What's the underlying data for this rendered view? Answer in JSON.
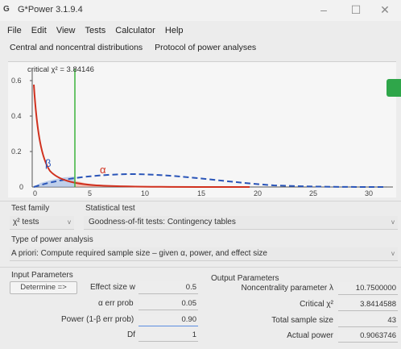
{
  "window": {
    "title": "G*Power 3.1.9.4",
    "icon": "gpower-icon"
  },
  "menu": [
    "File",
    "Edit",
    "View",
    "Tests",
    "Calculator",
    "Help"
  ],
  "tabs": [
    "Central and noncentral distributions",
    "Protocol of power analyses"
  ],
  "graph": {
    "critical_label": "critical χ² = 3.84146",
    "y_ticks": [
      "0.6",
      "0.4",
      "0.2",
      "0"
    ],
    "x_ticks": [
      "0",
      "5",
      "10",
      "15",
      "20",
      "25",
      "30"
    ],
    "beta_label": "β",
    "alpha_label": "α",
    "colors": {
      "central": "#d0311f",
      "noncentral": "#2a55b8",
      "critical": "#3cb43c"
    }
  },
  "test_family": {
    "label": "Test family",
    "value": "χ² tests"
  },
  "statistical_test": {
    "label": "Statistical test",
    "value": "Goodness-of-fit tests: Contingency tables"
  },
  "analysis": {
    "label": "Type of power analysis",
    "value": "A priori: Compute required sample size – given α, power, and effect size"
  },
  "input": {
    "heading": "Input Parameters",
    "determine_label": "Determine =>",
    "effect_label": "Effect size w",
    "effect_value": "0.5",
    "alpha_label": "α err prob",
    "alpha_value": "0.05",
    "power_label": "Power (1-β err prob)",
    "power_value": "0.90",
    "df_label": "Df",
    "df_value": "1"
  },
  "output": {
    "heading": "Output Parameters",
    "noncent_label": "Noncentrality parameter λ",
    "noncent_value": "10.7500000",
    "critical_label": "Critical χ²",
    "critical_value": "3.8414588",
    "sample_label": "Total sample size",
    "sample_value": "43",
    "actual_label": "Actual power",
    "actual_value": "0.9063746"
  }
}
